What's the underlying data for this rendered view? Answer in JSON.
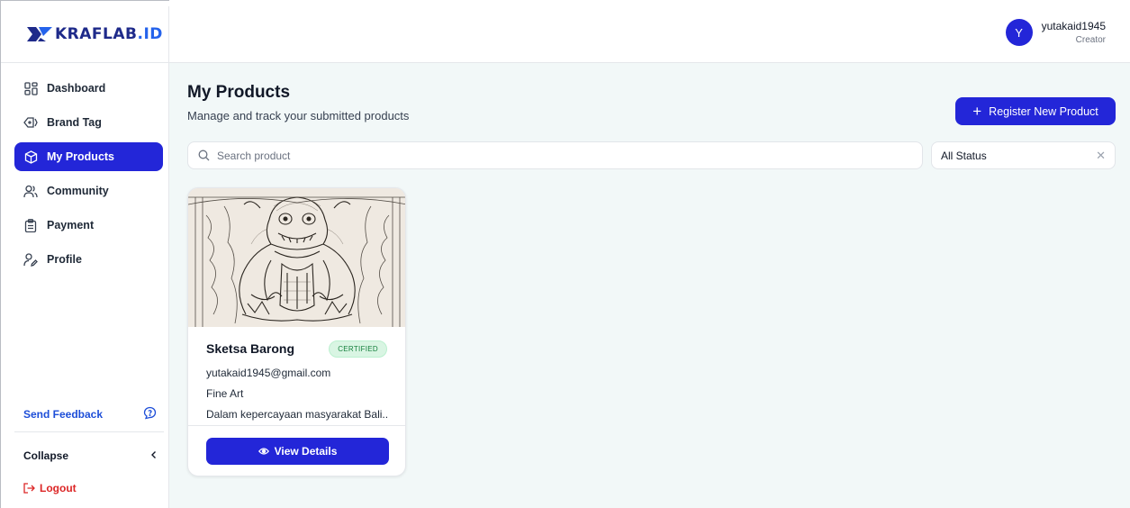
{
  "brand": {
    "name": "KRAFLAB",
    "suffix": ".ID"
  },
  "user": {
    "initial": "Y",
    "name": "yutakaid1945",
    "role": "Creator"
  },
  "sidebar": {
    "items": [
      {
        "label": "Dashboard",
        "icon": "dashboard-grid-icon",
        "active": false
      },
      {
        "label": "Brand Tag",
        "icon": "tag-icon",
        "active": false
      },
      {
        "label": "My Products",
        "icon": "box-icon",
        "active": true
      },
      {
        "label": "Community",
        "icon": "users-icon",
        "active": false
      },
      {
        "label": "Payment",
        "icon": "clipboard-icon",
        "active": false
      },
      {
        "label": "Profile",
        "icon": "user-edit-icon",
        "active": false
      }
    ],
    "feedback_label": "Send Feedback",
    "collapse_label": "Collapse",
    "logout_label": "Logout"
  },
  "main": {
    "title": "My Products",
    "subtitle": "Manage and track your submitted products",
    "register_label": "Register New Product",
    "search_placeholder": "Search product",
    "status_filter": "All Status"
  },
  "products": [
    {
      "name": "Sketsa Barong",
      "badge": "CERTIFIED",
      "email": "yutakaid1945@gmail.com",
      "category": "Fine Art",
      "description": "Dalam kepercayaan masyarakat Bali...",
      "button_label": "View Details"
    }
  ],
  "colors": {
    "accent": "#2326d8",
    "logo_text": "#1e2a8a",
    "certified_bg": "#d9f5e3",
    "certified_text": "#15803d",
    "logout": "#dc2626",
    "main_bg": "#f2f8f8"
  }
}
